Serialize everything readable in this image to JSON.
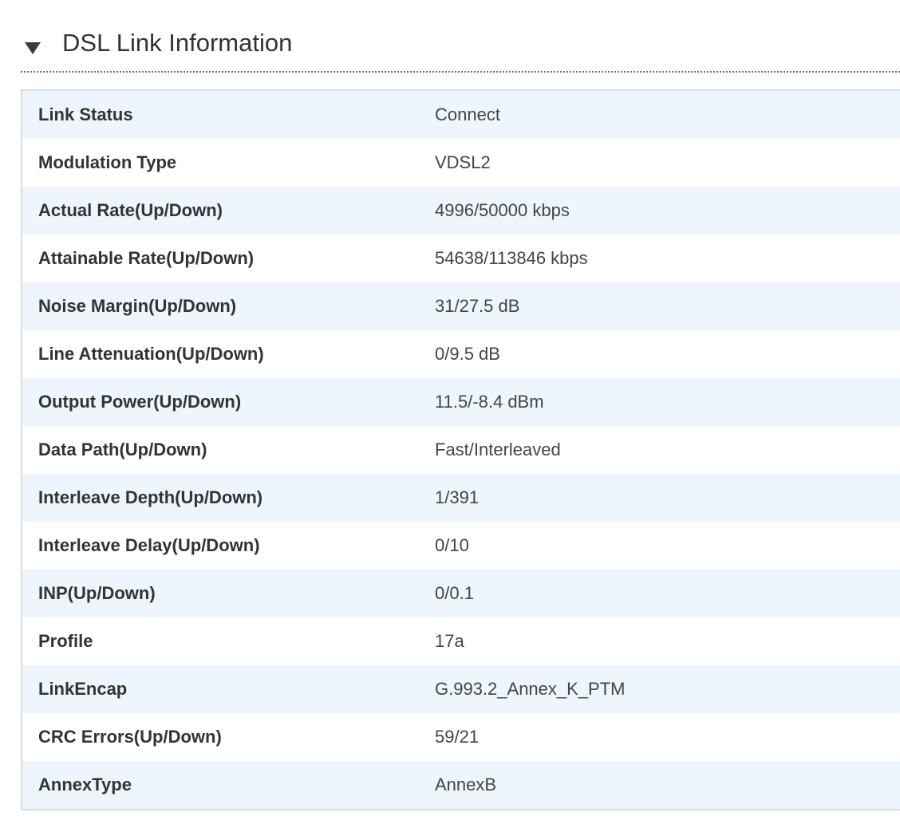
{
  "section": {
    "title": "DSL Link Information",
    "toggle_icon": "triangle-down-icon"
  },
  "rows": [
    {
      "label": "Link Status",
      "value": "Connect"
    },
    {
      "label": "Modulation Type",
      "value": "VDSL2"
    },
    {
      "label": "Actual Rate(Up/Down)",
      "value": "4996/50000 kbps"
    },
    {
      "label": "Attainable Rate(Up/Down)",
      "value": "54638/113846 kbps"
    },
    {
      "label": "Noise Margin(Up/Down)",
      "value": "31/27.5 dB"
    },
    {
      "label": "Line Attenuation(Up/Down)",
      "value": "0/9.5 dB"
    },
    {
      "label": "Output Power(Up/Down)",
      "value": "11.5/-8.4 dBm"
    },
    {
      "label": "Data Path(Up/Down)",
      "value": "Fast/Interleaved"
    },
    {
      "label": "Interleave Depth(Up/Down)",
      "value": "1/391"
    },
    {
      "label": "Interleave Delay(Up/Down)",
      "value": "0/10"
    },
    {
      "label": "INP(Up/Down)",
      "value": "0/0.1"
    },
    {
      "label": "Profile",
      "value": "17a"
    },
    {
      "label": "LinkEncap",
      "value": "G.993.2_Annex_K_PTM"
    },
    {
      "label": "CRC Errors(Up/Down)",
      "value": "59/21"
    },
    {
      "label": "AnnexType",
      "value": "AnnexB"
    }
  ],
  "colors": {
    "row_alt": "#eef5fc",
    "row": "#ffffff",
    "border": "#d6dde5",
    "text": "#333333"
  }
}
